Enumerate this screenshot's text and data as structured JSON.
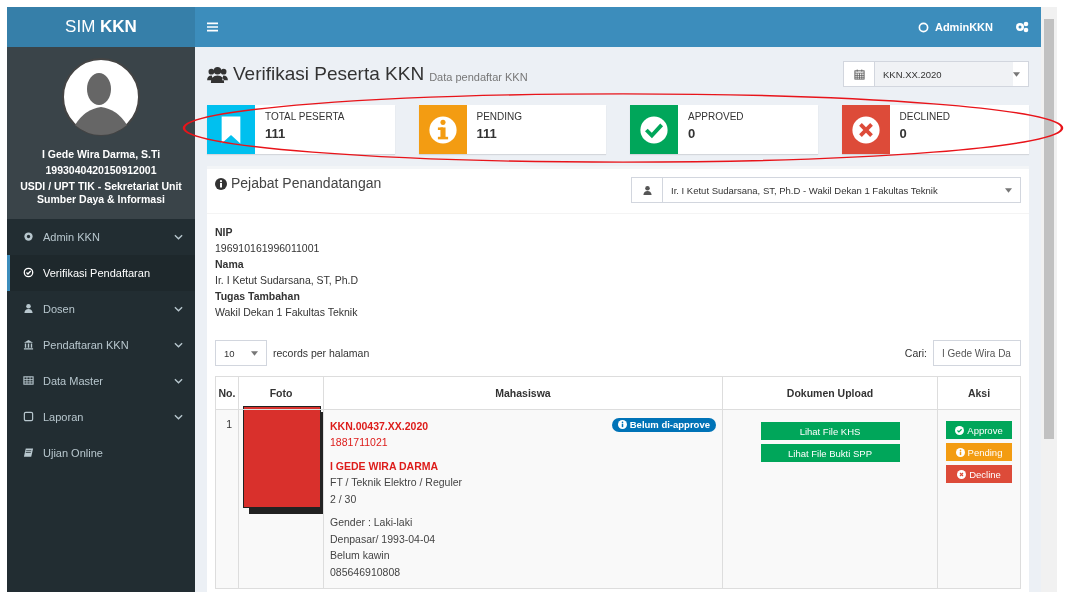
{
  "brand": {
    "text": "SIM **KKN**"
  },
  "user_menu": {
    "name": "AdminKKN"
  },
  "profile": {
    "name": "I Gede Wira Darma, S.Ti",
    "id": "1993040420150912001",
    "unit": "USDI / UPT TIK - Sekretariat Unit Sumber Daya & Informasi"
  },
  "sidebar": {
    "items": [
      {
        "label": "Admin KKN",
        "expandable": true,
        "selected": false
      },
      {
        "label": "Verifikasi Pendaftaran",
        "expandable": false,
        "selected": true
      },
      {
        "label": "Dosen",
        "expandable": true,
        "selected": false
      },
      {
        "label": "Pendaftaran KKN",
        "expandable": true,
        "selected": false
      },
      {
        "label": "Data Master",
        "expandable": true,
        "selected": false
      },
      {
        "label": "Laporan",
        "expandable": true,
        "selected": false
      },
      {
        "label": "Ujian Online",
        "expandable": false,
        "selected": false
      }
    ]
  },
  "page": {
    "title": "Verifikasi Peserta KKN",
    "subtitle": "Data pendaftar KKN",
    "period": "KKN.XX.2020"
  },
  "info_boxes": [
    {
      "kind": "bookmark",
      "label": "TOTAL PESERTA",
      "value": "111",
      "color": "#00c0ef"
    },
    {
      "kind": "info",
      "label": "PENDING",
      "value": "111",
      "color": "#f39c12"
    },
    {
      "kind": "check",
      "label": "APPROVED",
      "value": "0",
      "color": "#00a65a"
    },
    {
      "kind": "times",
      "label": "DECLINED",
      "value": "0",
      "color": "#dd4b39"
    }
  ],
  "signer": {
    "title": "Pejabat Penandatangan",
    "selected": "Ir. I Ketut Sudarsana, ST, Ph.D - Wakil Dekan 1 Fakultas Teknik",
    "fields": [
      {
        "label": "NIP",
        "value": "196910161996011001"
      },
      {
        "label": "Nama",
        "value": "Ir. I Ketut Sudarsana, ST, Ph.D"
      },
      {
        "label": "Tugas Tambahan",
        "value": "Wakil Dekan 1 Fakultas Teknik"
      }
    ]
  },
  "table": {
    "page_size": "10",
    "page_size_label": "records per halaman",
    "search_label": "Cari:",
    "search_value": "I Gede Wira Da",
    "columns": [
      "No.",
      "Foto",
      "Mahasiswa",
      "Dokumen Upload",
      "Aksi"
    ],
    "rows": [
      {
        "no": "1",
        "code": "KKN.00437.XX.2020",
        "nim": "1881711021",
        "name": "I GEDE WIRA DARMA",
        "program": "FT / Teknik Elektro / Reguler",
        "semester": "2 / 30",
        "status": "Belum di-approve",
        "details": [
          "Gender : Laki-laki",
          "Denpasar/ 1993-04-04",
          "Belum kawin",
          "085646910808"
        ],
        "documents": [
          "Lihat File KHS",
          "Lihat File Bukti SPP"
        ],
        "actions": [
          {
            "kind": "approve",
            "label": "Approve"
          },
          {
            "kind": "pending",
            "label": "Pending"
          },
          {
            "kind": "decline",
            "label": "Decline"
          }
        ]
      }
    ]
  }
}
